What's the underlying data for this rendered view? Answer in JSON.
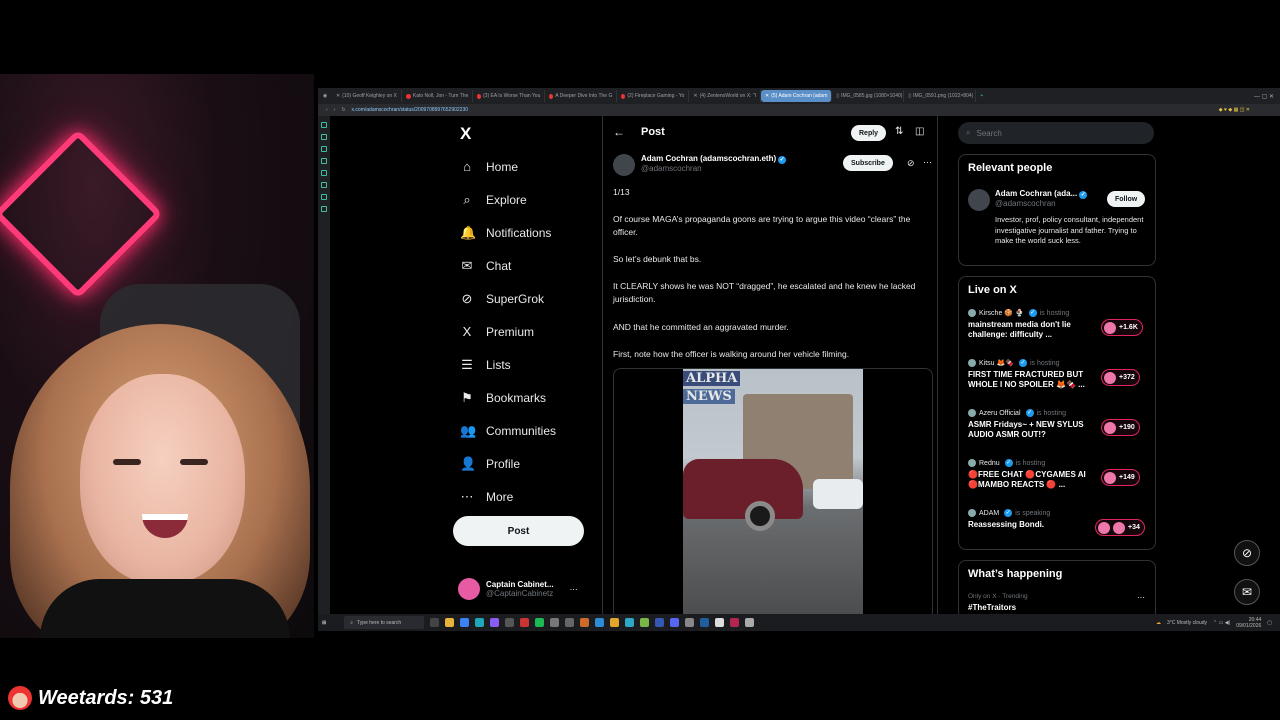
{
  "browser": {
    "tabs": [
      {
        "label": "(10) Geoff Keighley on X",
        "active": false
      },
      {
        "label": "Kato Noll, Jon - Turn The",
        "active": false
      },
      {
        "label": "(3) EA Is Worse Than You",
        "active": false
      },
      {
        "label": "A Deeper Dive Into The G",
        "active": false
      },
      {
        "label": "(2) Fireplace Gaming - Yo",
        "active": false
      },
      {
        "label": "(4) ZentenoWorld on X: \"I",
        "active": false
      },
      {
        "label": "(5) Adam Cochran (adam",
        "active": true
      },
      {
        "label": "IMG_0585.jpg (1080×1040)",
        "active": false
      },
      {
        "label": "IMG_0591.png (1022×804)",
        "active": false
      }
    ],
    "url": "x.com/adamscochran/status/2009708997652902230"
  },
  "nav": {
    "logo": "X",
    "items": [
      {
        "icon": "⌂",
        "label": "Home",
        "name": "home"
      },
      {
        "icon": "⌕",
        "label": "Explore",
        "name": "explore"
      },
      {
        "icon": "🔔",
        "label": "Notifications",
        "name": "notifications"
      },
      {
        "icon": "✉",
        "label": "Chat",
        "name": "chat"
      },
      {
        "icon": "⊘",
        "label": "SuperGrok",
        "name": "supergrok"
      },
      {
        "icon": "X",
        "label": "Premium",
        "name": "premium"
      },
      {
        "icon": "☰",
        "label": "Lists",
        "name": "lists"
      },
      {
        "icon": "⚑",
        "label": "Bookmarks",
        "name": "bookmarks"
      },
      {
        "icon": "👥",
        "label": "Communities",
        "name": "communities"
      },
      {
        "icon": "👤",
        "label": "Profile",
        "name": "profile"
      },
      {
        "icon": "⋯",
        "label": "More",
        "name": "more"
      }
    ],
    "post_button": "Post",
    "account": {
      "name": "Captain Cabinet...",
      "handle": "@CaptainCabinetz"
    }
  },
  "post": {
    "header_title": "Post",
    "reply_button": "Reply",
    "author_name": "Adam Cochran (adamscochran.eth)",
    "author_handle": "@adamscochran",
    "subscribe_button": "Subscribe",
    "paragraphs": [
      "1/13",
      "Of course MAGA’s propaganda goons are trying to argue this video “clears” the officer.",
      "So let’s debunk that bs.",
      "It CLEARLY shows he was NOT “dragged”, he escalated and he knew he lacked jurisdiction.",
      "AND that he committed an aggravated murder.",
      "First, note how the officer is walking around her vehicle filming."
    ],
    "video_watermark_line1": "ALPHA",
    "video_watermark_line2": "NEWS"
  },
  "sidebar": {
    "search_placeholder": "Search",
    "relevant_title": "Relevant people",
    "relevant_person": {
      "name": "Adam Cochran (ada...",
      "handle": "@adamscochran",
      "follow_button": "Follow",
      "bio": "Investor, prof, policy consultant, independent investigative journalist and father. Trying to make the world suck less."
    },
    "live_title": "Live on X",
    "live": [
      {
        "host": "Kirsche 🍪 🍨",
        "status": "is hosting",
        "title": "mainstream media don't lie challenge: difficulty ...",
        "count": "+1.6K"
      },
      {
        "host": "Kitsu 🦊🍫",
        "status": "is hosting",
        "title": "FIRST TIME FRACTURED BUT WHOLE I NO SPOILER 🦊🍫 ...",
        "count": "+372"
      },
      {
        "host": "Azeru Official",
        "status": "is hosting",
        "title": "ASMR Fridays~ + NEW SYLUS AUDIO ASMR OUT!?",
        "count": "+190"
      },
      {
        "host": "Rednu",
        "status": "is hosting",
        "title": "🔴FREE CHAT 🔴CYGAMES AI 🔴MAMBO REACTS 🔴 ...",
        "count": "+149"
      },
      {
        "host": "ADAM",
        "status": "is speaking",
        "title": "Reassessing Bondi.",
        "count": "+34"
      }
    ],
    "happening_title": "What’s happening",
    "trend_context": "Only on X · Trending",
    "trend_name": "#TheTraitors"
  },
  "taskbar": {
    "search_placeholder": "Type here to search",
    "weather": "3°C  Mostly cloudy",
    "time": "20:44",
    "date": "09/01/2026"
  },
  "overlay": {
    "counter_label": "Weetards: 531"
  }
}
